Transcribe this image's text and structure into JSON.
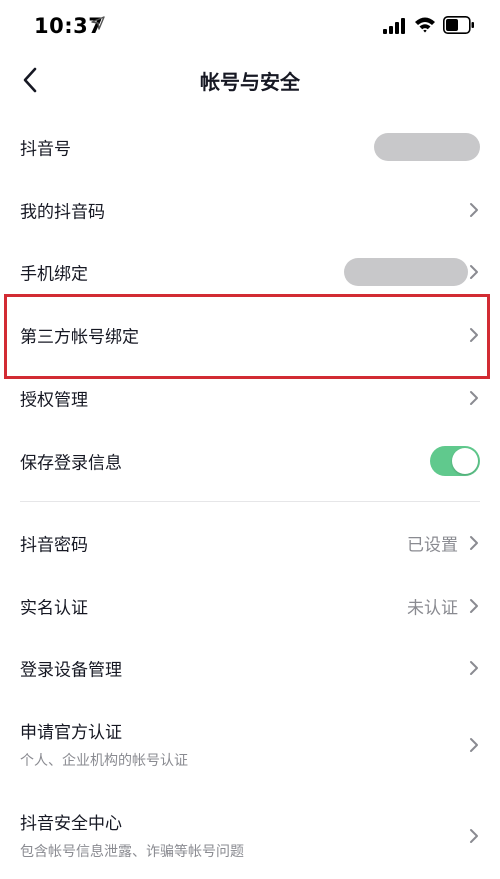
{
  "status_bar": {
    "time": "10:37",
    "icons": [
      "location-arrow-icon",
      "signal-icon",
      "wifi-icon",
      "battery-icon"
    ]
  },
  "nav": {
    "title": "帐号与安全",
    "back_icon": "chevron-left-icon"
  },
  "rows": [
    {
      "label": "抖音号",
      "value_hidden": true
    },
    {
      "label": "我的抖音码"
    },
    {
      "label": "手机绑定",
      "value_hidden": true
    },
    {
      "label": "第三方帐号绑定",
      "highlighted": true
    },
    {
      "label": "授权管理"
    },
    {
      "label": "保存登录信息",
      "toggle_on": true
    },
    {
      "label": "抖音密码",
      "value": "已设置"
    },
    {
      "label": "实名认证",
      "value": "未认证"
    },
    {
      "label": "登录设备管理"
    },
    {
      "label": "申请官方认证",
      "sub": "个人、企业机构的帐号认证"
    },
    {
      "label": "抖音安全中心",
      "sub": "包含帐号信息泄露、诈骗等帐号问题"
    }
  ],
  "colors": {
    "toggle_on": "#60c98d",
    "highlight_border": "#d22b33",
    "secondary_text": "#8a8b91",
    "primary_text": "#161823"
  }
}
